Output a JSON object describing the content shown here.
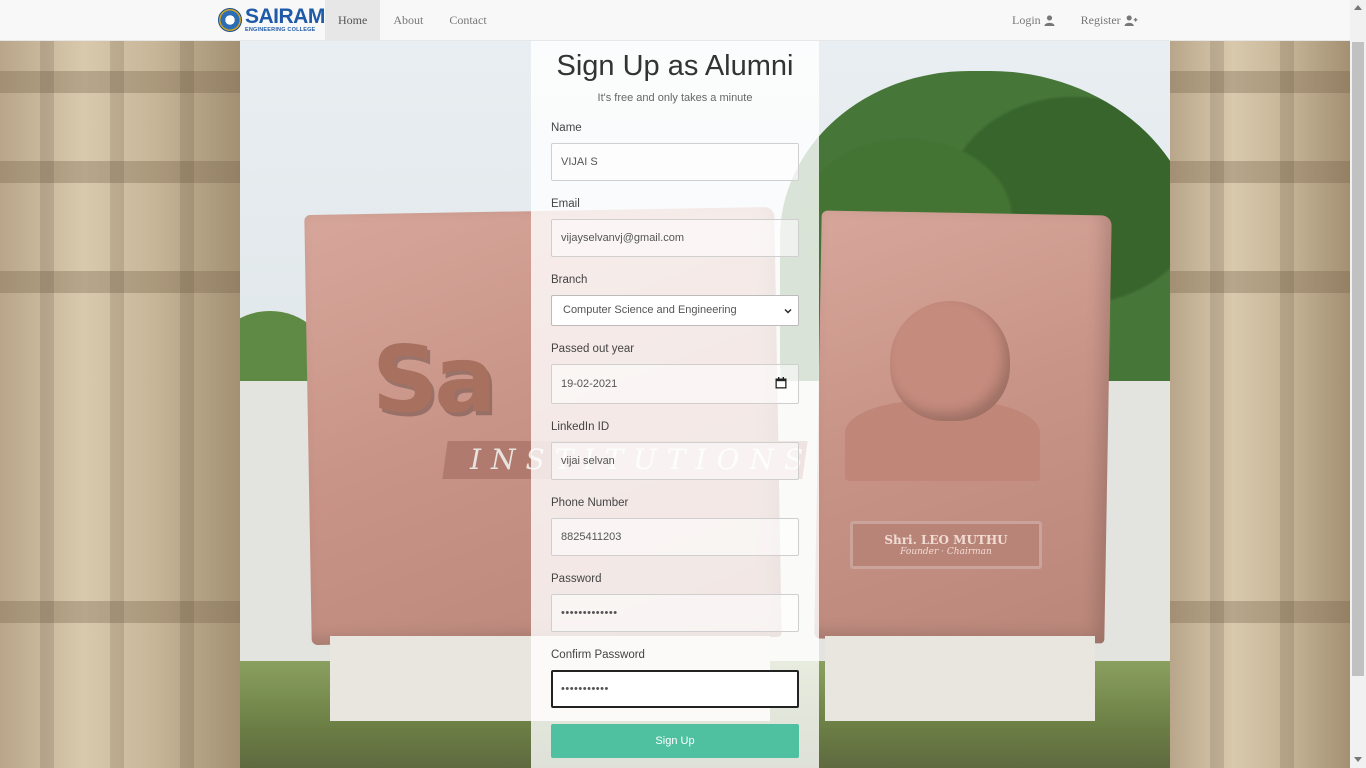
{
  "brand": {
    "name": "SAIRAM",
    "tagline": "ENGINEERING COLLEGE",
    "icon": "college-seal-icon"
  },
  "nav": {
    "links": [
      {
        "label": "Home",
        "active": true
      },
      {
        "label": "About",
        "active": false
      },
      {
        "label": "Contact",
        "active": false
      }
    ],
    "login": {
      "label": "Login",
      "icon": "user-icon"
    },
    "register": {
      "label": "Register",
      "icon": "user-plus-icon"
    }
  },
  "scene": {
    "logo_text": "Sa",
    "band_text": "INSTITUTIONS",
    "plaque_name": "Shri. LEO MUTHU",
    "plaque_role": "Founder · Chairman"
  },
  "form": {
    "title": "Sign Up as Alumni",
    "subtitle": "It's free and only takes a minute",
    "fields": {
      "name": {
        "label": "Name",
        "value": "VIJAI S"
      },
      "email": {
        "label": "Email",
        "value": "vijayselvanvj@gmail.com"
      },
      "branch": {
        "label": "Branch",
        "value": "Computer Science and Engineering"
      },
      "passed_year": {
        "label": "Passed out year",
        "value": "19-02-2021"
      },
      "linkedin": {
        "label": "LinkedIn ID",
        "value": "vijai selvan"
      },
      "phone": {
        "label": "Phone Number",
        "value": "8825411203"
      },
      "password": {
        "label": "Password",
        "value": "•••••••••••••"
      },
      "confirm_password": {
        "label": "Confirm Password",
        "value": "•••••••••••"
      }
    },
    "submit_label": "Sign Up"
  },
  "colors": {
    "accent": "#4fc1a1",
    "brand": "#1f5aa8",
    "nav_bg": "#f8f8f8"
  }
}
